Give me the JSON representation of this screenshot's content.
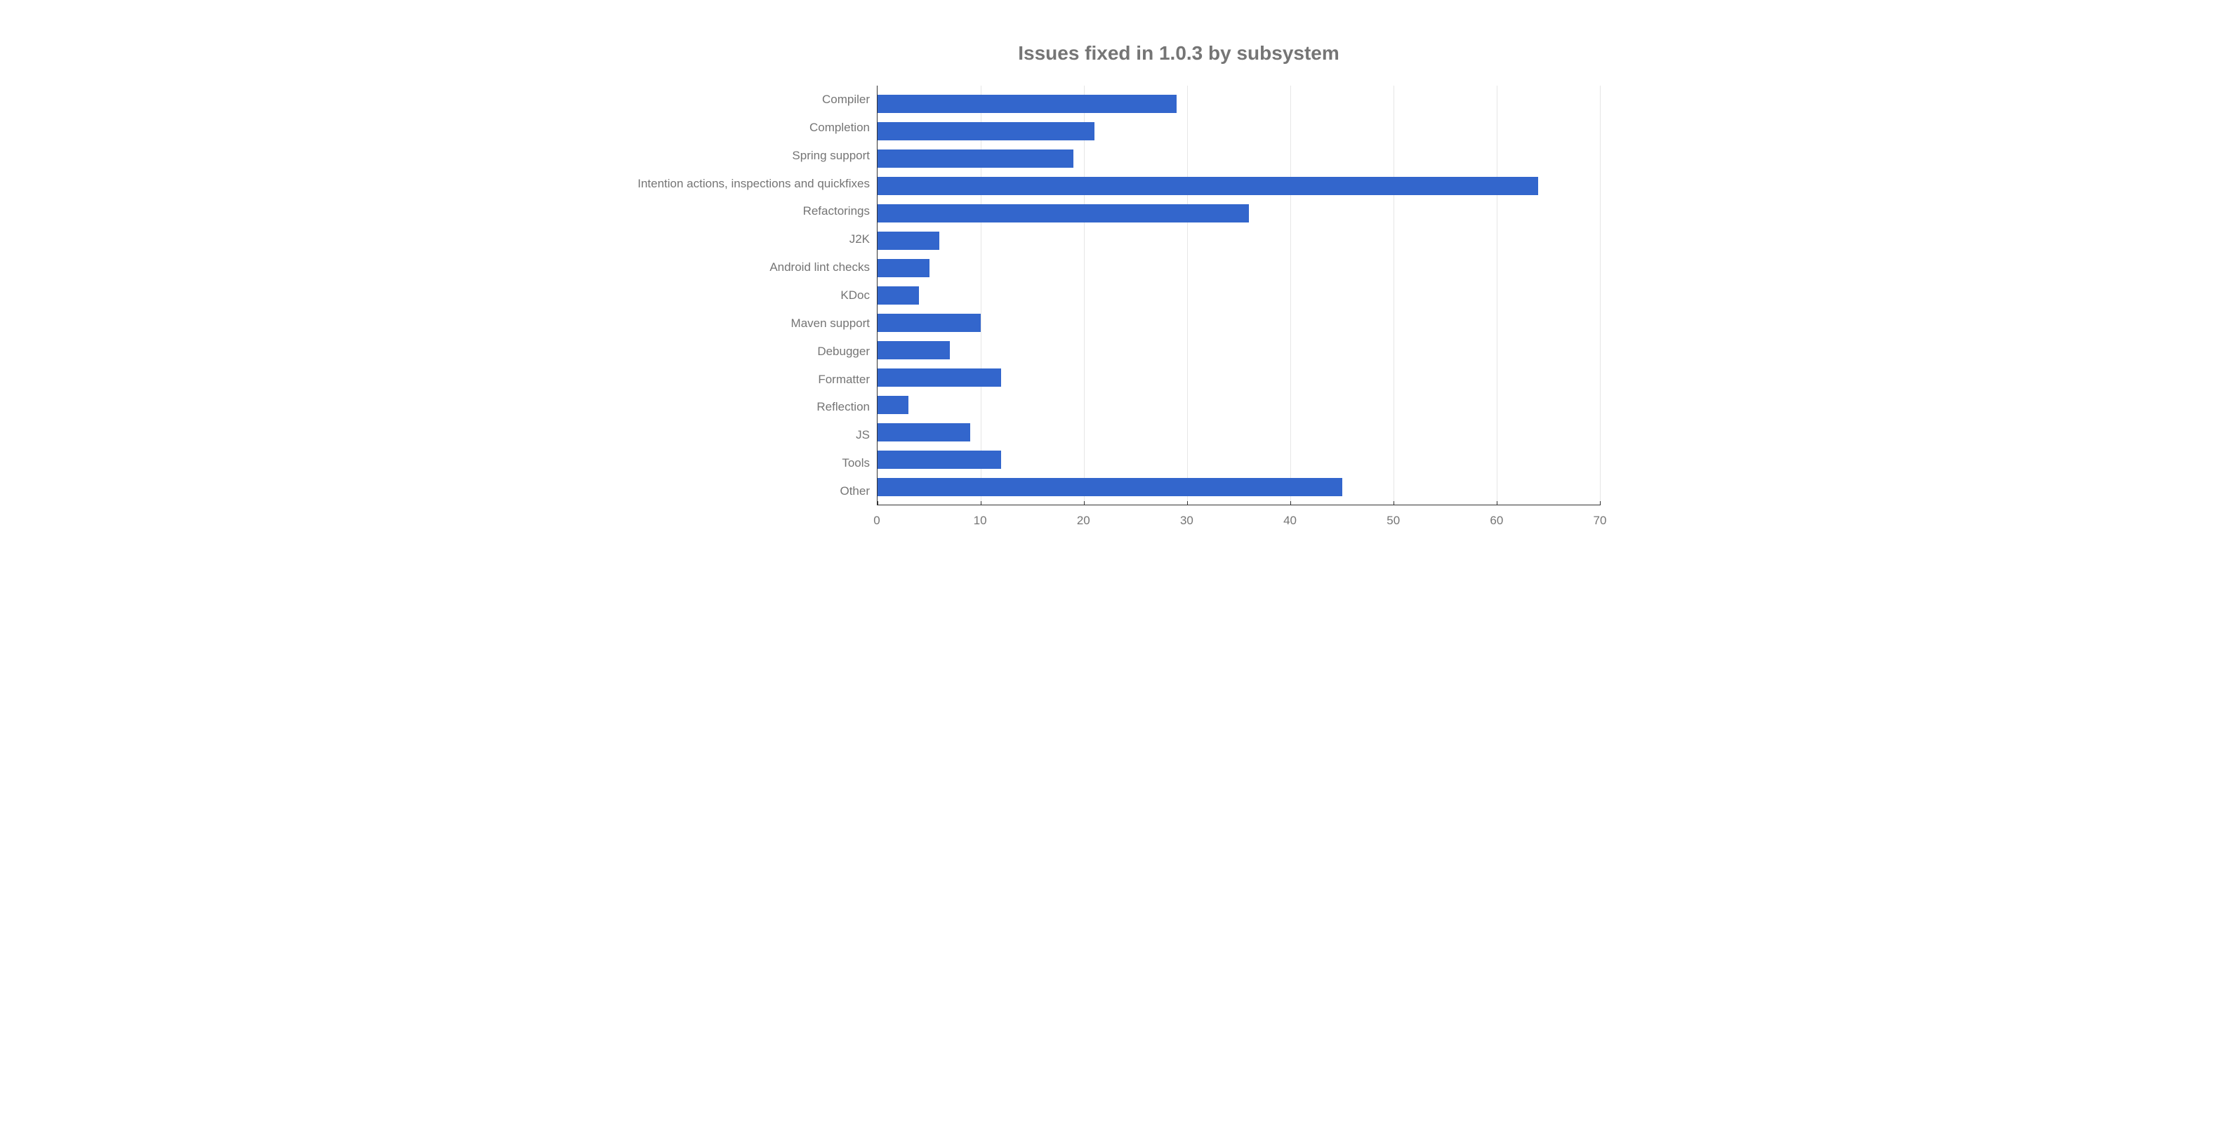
{
  "chart_data": {
    "type": "bar",
    "orientation": "horizontal",
    "title": "Issues fixed in 1.0.3 by subsystem",
    "categories": [
      "Compiler",
      "Completion",
      "Spring support",
      "Intention actions, inspections and quickfixes",
      "Refactorings",
      "J2K",
      "Android lint checks",
      "KDoc",
      "Maven support",
      "Debugger",
      "Formatter",
      "Reflection",
      "JS",
      "Tools",
      "Other"
    ],
    "values": [
      29,
      21,
      19,
      64,
      36,
      6,
      5,
      4,
      10,
      7,
      12,
      3,
      9,
      12,
      45
    ],
    "xlim": [
      0,
      70
    ],
    "x_ticks": [
      0,
      10,
      20,
      30,
      40,
      50,
      60,
      70
    ],
    "bar_color": "#3366cc",
    "xlabel": "",
    "ylabel": ""
  }
}
